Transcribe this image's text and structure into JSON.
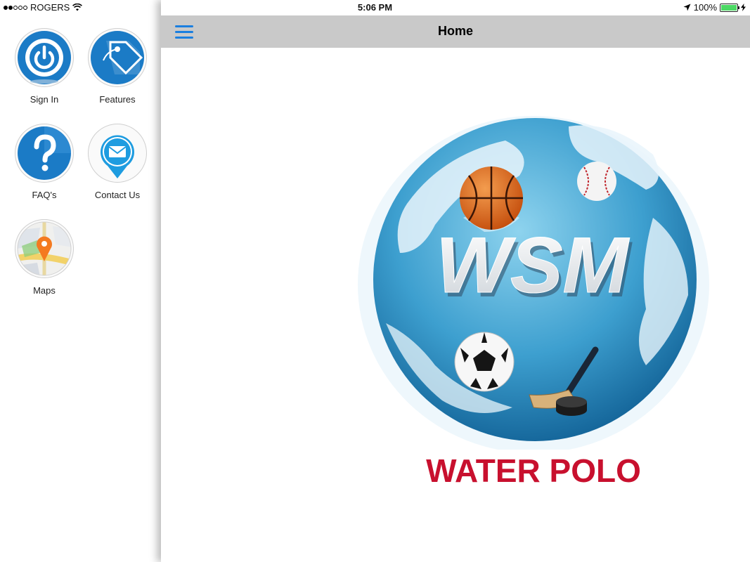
{
  "status_bar": {
    "carrier": "ROGERS",
    "time": "5:06 PM",
    "battery": "100%"
  },
  "sidebar": {
    "items": [
      {
        "label": "Sign In",
        "icon": "power-icon"
      },
      {
        "label": "Features",
        "icon": "tag-icon"
      },
      {
        "label": "FAQ's",
        "icon": "question-icon"
      },
      {
        "label": "Contact Us",
        "icon": "envelope-pin-icon"
      },
      {
        "label": "Maps",
        "icon": "map-pin-icon"
      }
    ]
  },
  "header": {
    "title": "Home"
  },
  "logo": {
    "text": "WSM",
    "caption": "WATER POLO"
  },
  "colors": {
    "accent": "#1a7fe0",
    "icon_blue": "#1b7bc6",
    "header_bg": "#c9c9c9",
    "caption_red": "#c8102e"
  }
}
